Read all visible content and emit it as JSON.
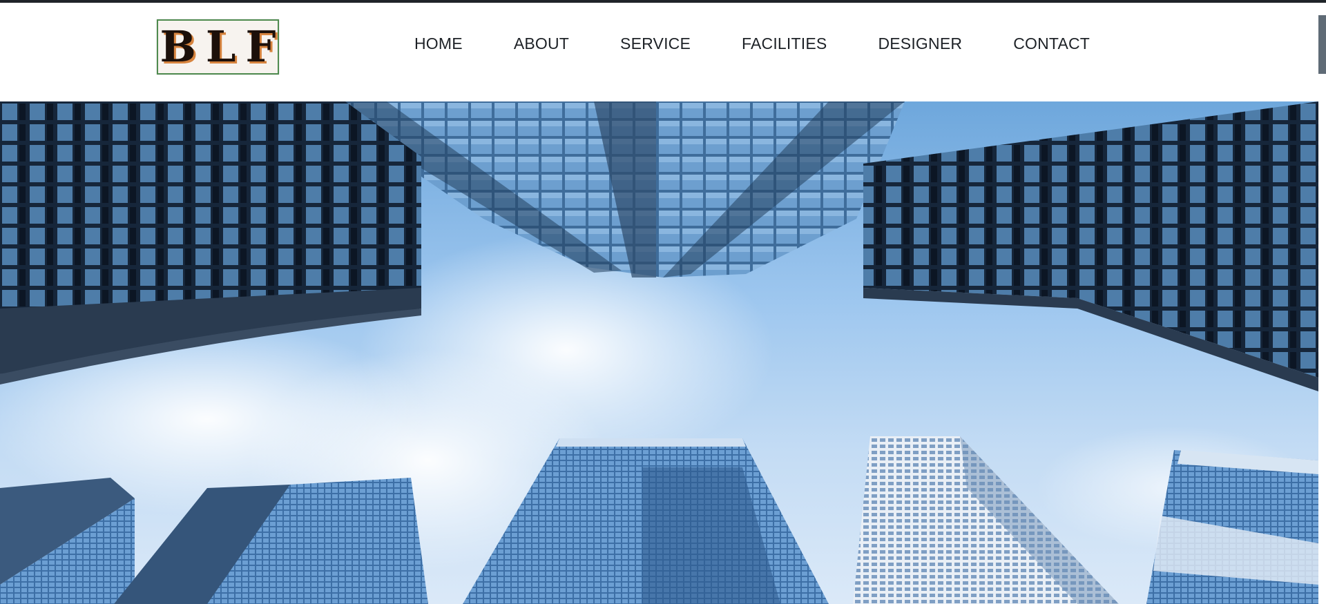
{
  "brand": {
    "logo_text": "BLF"
  },
  "nav": {
    "items": [
      {
        "label": "HOME"
      },
      {
        "label": "ABOUT"
      },
      {
        "label": "SERVICE"
      },
      {
        "label": "FACILITIES"
      },
      {
        "label": "DESIGNER"
      },
      {
        "label": "CONTACT"
      }
    ]
  },
  "colors": {
    "topbar": "#1f2429",
    "nav_text": "#1d2126",
    "logo_border": "#4f8b4f",
    "logo_shadow": "#d7843f",
    "scrollbar_thumb": "#5f6b76"
  },
  "hero": {
    "image": "skyscrapers-looking-up-at-sky-photo"
  }
}
